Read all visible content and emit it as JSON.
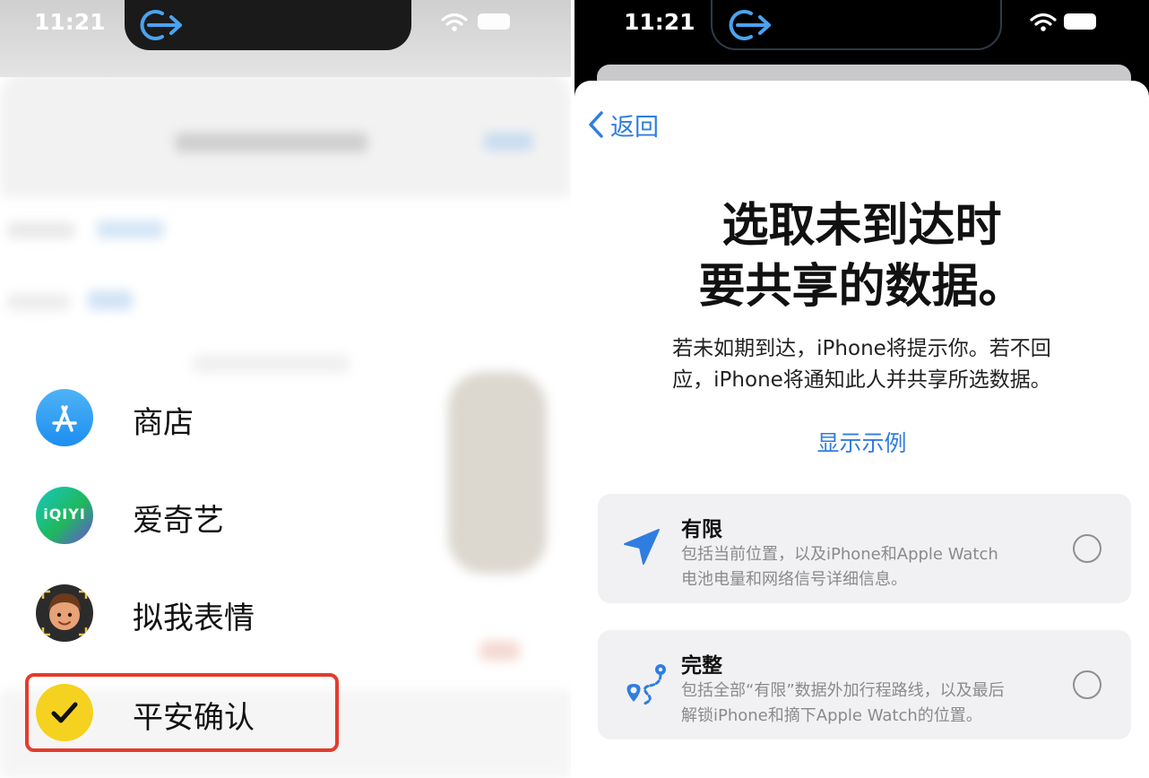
{
  "left": {
    "status_bar": {
      "time": "11:21"
    },
    "menu": [
      {
        "label": "商店",
        "icon": "app-store-icon"
      },
      {
        "label": "爱奇艺",
        "icon": "iqiyi-icon",
        "icon_text": "iQIYI"
      },
      {
        "label": "拟我表情",
        "icon": "memoji-icon"
      },
      {
        "label": "平安确认",
        "icon": "check-in-icon",
        "highlighted": true
      }
    ],
    "colors": {
      "highlight_border": "#e43c2c",
      "check_in_yellow": "#f5d21f",
      "store_blue": "#1d8ef0"
    }
  },
  "right": {
    "status_bar": {
      "time": "11:21"
    },
    "nav": {
      "back_label": "返回"
    },
    "title_lines": [
      "选取未到达时",
      "要共享的数据。"
    ],
    "description_lines": [
      "若未如期到达，iPhone将提示你。若不回",
      "应，iPhone将通知此人并共享所选数据。"
    ],
    "show_example": "显示示例",
    "options": [
      {
        "title": "有限",
        "icon": "location-arrow-icon",
        "description_lines": [
          "包括当前位置，以及iPhone和Apple Watch",
          "电池电量和网络信号详细信息。"
        ],
        "selected": false
      },
      {
        "title": "完整",
        "icon": "route-icon",
        "description_lines": [
          "包括全部“有限”数据外加行程路线，以及最后",
          "解锁iPhone和摘下Apple Watch的位置。"
        ],
        "selected": false
      }
    ],
    "colors": {
      "accent": "#2f7de1",
      "option_bg": "#f1f1f3"
    }
  }
}
